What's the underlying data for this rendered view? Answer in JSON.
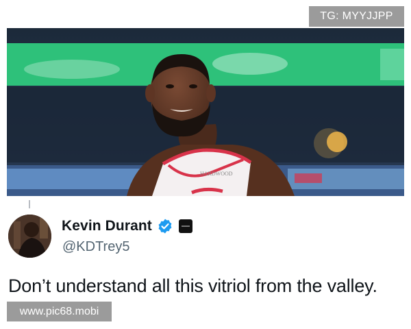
{
  "watermarks": {
    "top": "TG: MYYJJPP",
    "bottom": "www.pic68.mobi"
  },
  "photo": {
    "jersey_lettering": "HARDWOOD",
    "colors": {
      "banner_green": "#27c277",
      "jersey": "#f4f0f1",
      "trim": "#d8334a"
    }
  },
  "tweet": {
    "display_name": "Kevin Durant",
    "handle": "@KDTrey5",
    "text": "Don’t understand all this vitriol from the valley.",
    "verified_color": "#1d9bf0"
  }
}
